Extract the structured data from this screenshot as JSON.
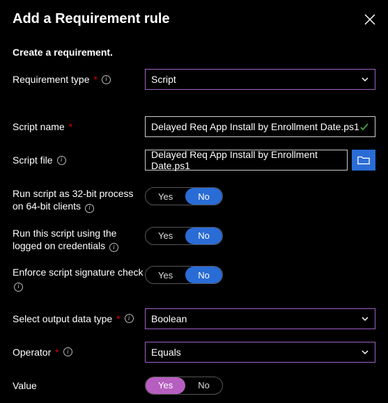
{
  "header": {
    "title": "Add a Requirement rule"
  },
  "subhead": "Create a requirement.",
  "fields": {
    "reqType": {
      "label": "Requirement type",
      "value": "Script"
    },
    "scriptName": {
      "label": "Script name",
      "value": "Delayed Req App Install by Enrollment Date.ps1"
    },
    "scriptFile": {
      "label": "Script file",
      "value": "Delayed Req App Install by Enrollment Date.ps1"
    },
    "run32": {
      "label": "Run script as 32-bit process on 64-bit clients",
      "yes": "Yes",
      "no": "No"
    },
    "loggedOn": {
      "label": "Run this script using the logged on credentials",
      "yes": "Yes",
      "no": "No"
    },
    "sigCheck": {
      "label": "Enforce script signature check",
      "yes": "Yes",
      "no": "No"
    },
    "outputType": {
      "label": "Select output data type",
      "value": "Boolean"
    },
    "operator": {
      "label": "Operator",
      "value": "Equals"
    },
    "value": {
      "label": "Value",
      "yes": "Yes",
      "no": "No"
    }
  }
}
